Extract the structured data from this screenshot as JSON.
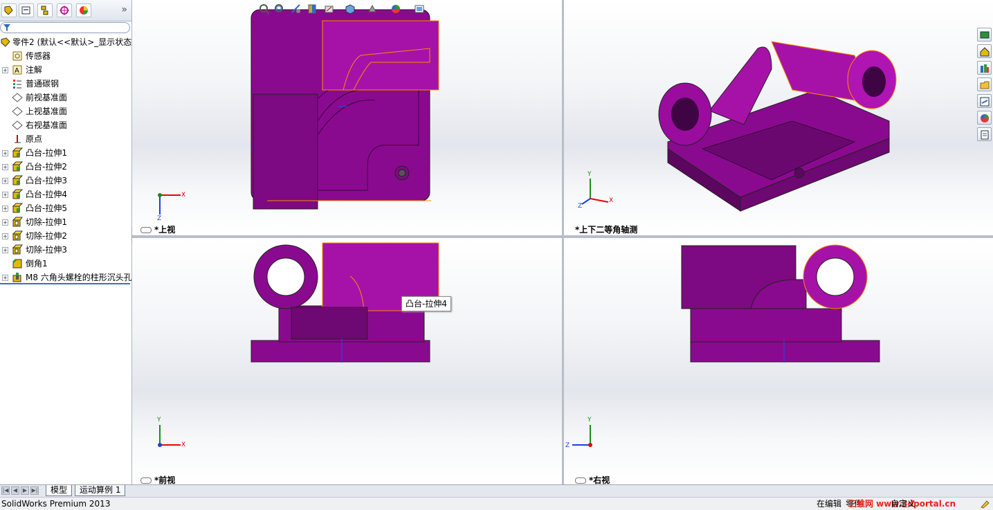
{
  "app": {
    "title": "SolidWorks Premium 2013"
  },
  "feature_tree": {
    "filter_icon": "filter-icon",
    "tabs": [
      "featuremanager-tab-icon",
      "propertymanager-tab-icon",
      "configurationmanager-tab-icon",
      "dimxpert-tab-icon",
      "display-manager-tab-icon"
    ],
    "items": [
      {
        "label": "零件2 (默认<<默认>_显示状态",
        "icon": "part-icon",
        "expandable": false
      },
      {
        "label": "传感器",
        "icon": "sensor-icon",
        "expandable": false
      },
      {
        "label": "注解",
        "icon": "annotation-icon",
        "expandable": true
      },
      {
        "label": "普通碳钢",
        "icon": "material-icon",
        "expandable": false
      },
      {
        "label": "前视基准面",
        "icon": "plane-icon",
        "expandable": false
      },
      {
        "label": "上视基准面",
        "icon": "plane-icon",
        "expandable": false
      },
      {
        "label": "右视基准面",
        "icon": "plane-icon",
        "expandable": false
      },
      {
        "label": "原点",
        "icon": "origin-icon",
        "expandable": false
      },
      {
        "label": "凸台-拉伸1",
        "icon": "boss-extrude-icon",
        "expandable": true
      },
      {
        "label": "凸台-拉伸2",
        "icon": "boss-extrude-icon",
        "expandable": true
      },
      {
        "label": "凸台-拉伸3",
        "icon": "boss-extrude-icon",
        "expandable": true
      },
      {
        "label": "凸台-拉伸4",
        "icon": "boss-extrude-icon",
        "expandable": true
      },
      {
        "label": "凸台-拉伸5",
        "icon": "boss-extrude-icon",
        "expandable": true
      },
      {
        "label": "切除-拉伸1",
        "icon": "cut-extrude-icon",
        "expandable": true
      },
      {
        "label": "切除-拉伸2",
        "icon": "cut-extrude-icon",
        "expandable": true
      },
      {
        "label": "切除-拉伸3",
        "icon": "cut-extrude-icon",
        "expandable": true
      },
      {
        "label": "倒角1",
        "icon": "chamfer-icon",
        "expandable": false
      },
      {
        "label": "M8 六角头螺栓的柱形沉头孔",
        "icon": "hole-wizard-icon",
        "expandable": true
      }
    ]
  },
  "bottom_tabs": {
    "model": "模型",
    "motion": "运动算例 1"
  },
  "viewports": {
    "top": {
      "label": "*上视"
    },
    "iso": {
      "label": "*上下二等角轴测"
    },
    "front": {
      "label": "*前视"
    },
    "right": {
      "label": "*右视"
    }
  },
  "triad": {
    "x": "X",
    "y": "Y",
    "z": "Z"
  },
  "tooltip": {
    "text": "凸台-拉伸4"
  },
  "status_bar": {
    "left": "SolidWorks Premium 2013",
    "editing": "在编辑",
    "editing_suffix": "零件",
    "custom": "自定义",
    "watermark": "三维网 www.3dportal.cn"
  },
  "colors": {
    "model_purple": "#8a0a8f",
    "highlight_orange": "#ff8c00",
    "accent_blue": "#3a6fc0"
  }
}
